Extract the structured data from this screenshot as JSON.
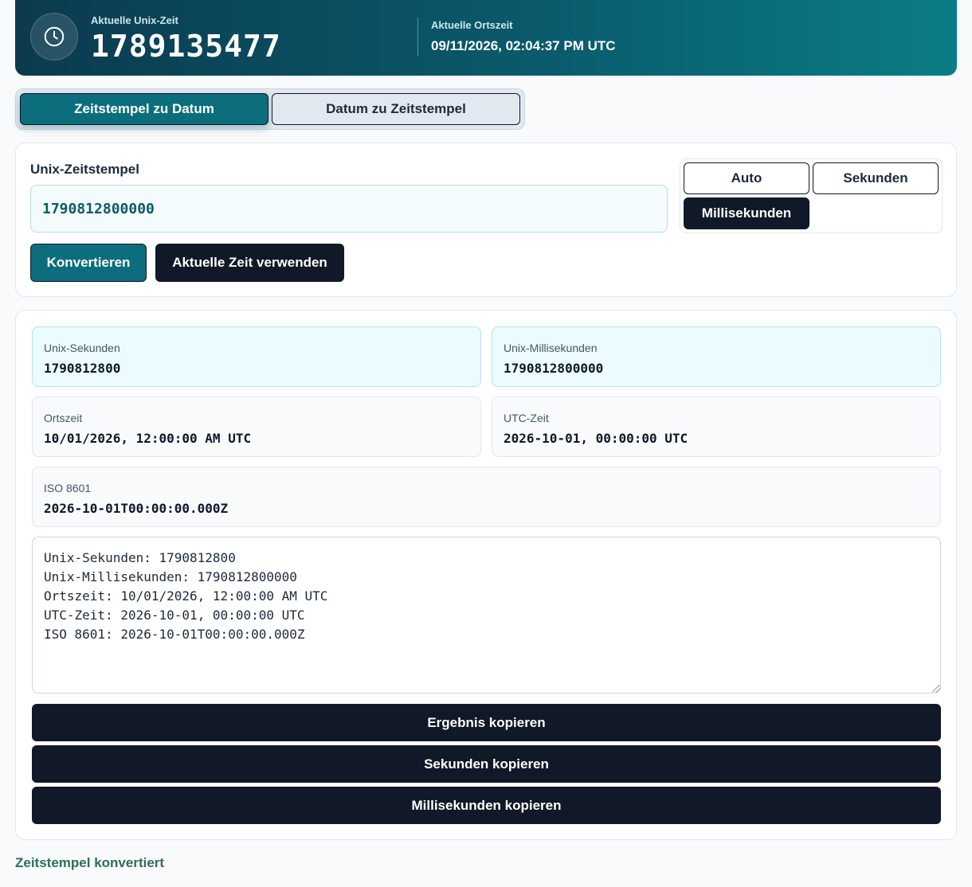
{
  "header": {
    "unix_label": "Aktuelle Unix-Zeit",
    "unix_value": "1789135477",
    "local_label": "Aktuelle Ortszeit",
    "local_value": "09/11/2026, 02:04:37 PM UTC",
    "icon": "clock-icon"
  },
  "tabs": [
    {
      "label": "Zeitstempel zu Datum",
      "active": true
    },
    {
      "label": "Datum zu Zeitstempel",
      "active": false
    }
  ],
  "input_card": {
    "label": "Unix-Zeitstempel",
    "value": "1790812800000",
    "units": [
      {
        "label": "Auto",
        "selected": false
      },
      {
        "label": "Sekunden",
        "selected": false
      },
      {
        "label": "Millisekunden",
        "selected": true
      }
    ],
    "convert_label": "Konvertieren",
    "now_label": "Aktuelle Zeit verwenden"
  },
  "results": {
    "unix_seconds": {
      "label": "Unix-Sekunden",
      "value": "1790812800"
    },
    "unix_millis": {
      "label": "Unix-Millisekunden",
      "value": "1790812800000"
    },
    "local_time": {
      "label": "Ortszeit",
      "value": "10/01/2026, 12:00:00 AM UTC"
    },
    "utc_time": {
      "label": "UTC-Zeit",
      "value": "2026-10-01, 00:00:00 UTC"
    },
    "iso": {
      "label": "ISO 8601",
      "value": "2026-10-01T00:00:00.000Z"
    },
    "summary_text": "Unix-Sekunden: 1790812800\nUnix-Millisekunden: 1790812800000\nOrtszeit: 10/01/2026, 12:00:00 AM UTC\nUTC-Zeit: 2026-10-01, 00:00:00 UTC\nISO 8601: 2026-10-01T00:00:00.000Z",
    "copy_result_label": "Ergebnis kopieren",
    "copy_seconds_label": "Sekunden kopieren",
    "copy_millis_label": "Millisekunden kopieren"
  },
  "status": "Zeitstempel konvertiert",
  "colors": {
    "accent": "#0c6e7c",
    "dark": "#111827",
    "status": "#2f6d5a"
  }
}
